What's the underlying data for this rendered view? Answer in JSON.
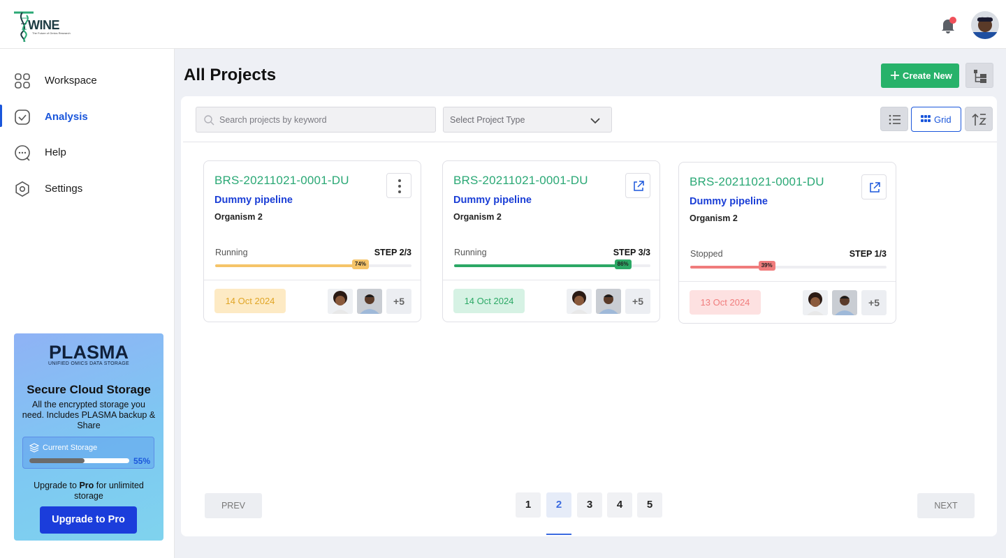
{
  "header": {
    "brand": "WINE",
    "tagline": "The Future of Omics Research",
    "notification_dot_color": "#f0505a"
  },
  "sidebar": {
    "items": [
      {
        "label": "Workspace",
        "icon": "grid-icon",
        "active": false
      },
      {
        "label": "Analysis",
        "icon": "checkbox-icon",
        "active": true
      },
      {
        "label": "Help",
        "icon": "help-chat-icon",
        "active": false
      },
      {
        "label": "Settings",
        "icon": "gear-icon",
        "active": false
      }
    ],
    "promo": {
      "logo": "PLASMA",
      "logo_sub": "UNIFIED OMICS DATA STORAGE",
      "title": "Secure Cloud Storage",
      "description": "All the encrypted storage you need. Includes PLASMA backup & Share",
      "storage_label": "Current Storage",
      "storage_percent": 55,
      "storage_percent_label": "55%",
      "upgrade_prefix": "Upgrade to ",
      "upgrade_plan": "Pro",
      "upgrade_suffix": " for unlimited storage",
      "button_label": "Upgrade to Pro"
    }
  },
  "main": {
    "title": "All Projects",
    "create_label": "Create New",
    "search_placeholder": "Search projects by keyword",
    "select_value": "Select Project Type",
    "grid_label": "Grid",
    "view_mode": "grid"
  },
  "projects": [
    {
      "code": "BRS-20211021-0001-DU",
      "pipeline": "Dummy pipeline",
      "organism": "Organism 2",
      "status": "Running",
      "step": "STEP 2/3",
      "progress": 74,
      "progress_label": "74%",
      "progress_color": "#f5c469",
      "date": "14 Oct 2024",
      "date_bg": "#fdeac4",
      "date_color": "#e0a526",
      "more": "+5",
      "action": "kebab"
    },
    {
      "code": "BRS-20211021-0001-DU",
      "pipeline": "Dummy pipeline",
      "organism": "Organism 2",
      "status": "Running",
      "step": "STEP 3/3",
      "progress": 86,
      "progress_label": "86%",
      "progress_color": "#2ba865",
      "date": "14 Oct 2024",
      "date_bg": "#d6f2e4",
      "date_color": "#2ba865",
      "more": "+5",
      "action": "external-link"
    },
    {
      "code": "BRS-20211021-0001-DU",
      "pipeline": "Dummy pipeline",
      "organism": "Organism 2",
      "status": "Stopped",
      "step": "STEP 1/3",
      "progress": 39,
      "progress_label": "39%",
      "progress_color": "#f07c7c",
      "date": "13 Oct 2024",
      "date_bg": "#fde1e1",
      "date_color": "#f07c7c",
      "more": "+5",
      "action": "external-link"
    }
  ],
  "pagination": {
    "prev_label": "PREV",
    "next_label": "NEXT",
    "pages": [
      "1",
      "2",
      "3",
      "4",
      "5"
    ],
    "current": "2"
  }
}
